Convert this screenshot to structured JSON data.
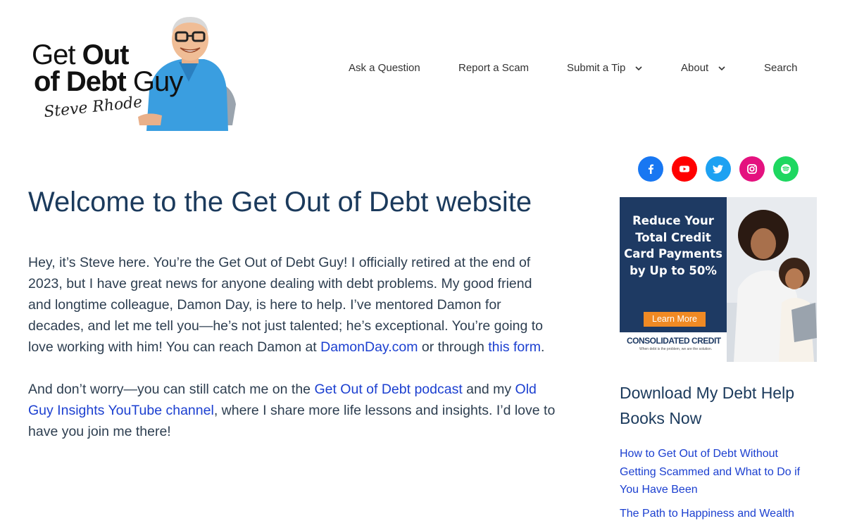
{
  "header": {
    "logo": {
      "line1_a": "Get ",
      "line1_b": "Out",
      "line2_a": "of Debt",
      "line2_b": " Guy",
      "signature": "Steve Rhode"
    },
    "nav": [
      {
        "label": "Ask a Question",
        "has_dropdown": false
      },
      {
        "label": "Report a Scam",
        "has_dropdown": false
      },
      {
        "label": "Submit a Tip",
        "has_dropdown": true
      },
      {
        "label": "About",
        "has_dropdown": true
      },
      {
        "label": "Search",
        "has_dropdown": false
      }
    ]
  },
  "main": {
    "title": "Welcome to the Get Out of Debt website",
    "para1": {
      "text": "Hey, it’s Steve here. You’re the Get Out of Debt Guy! I officially retired at the end of 2023, but I have great news for anyone dealing with debt problems. My good friend and longtime colleague, Damon Day, is here to help. I’ve mentored Damon for decades, and let me tell you—he’s not just talented; he’s exceptional. You’re going to love working with him! You can reach Damon at ",
      "link1": "DamonDay.com",
      "mid": " or through ",
      "link2": "this form",
      "end": "."
    },
    "para2": {
      "text": "And don’t worry—you can still catch me on the ",
      "link1": "Get Out of Debt podcast",
      "mid": " and my ",
      "link2": "Old Guy Insights YouTube channel",
      "end": ", where I share more life lessons and insights. I’d love to have you join me there!"
    }
  },
  "sidebar": {
    "socials": [
      {
        "name": "facebook",
        "color": "#1877f2"
      },
      {
        "name": "youtube",
        "color": "#ff0000"
      },
      {
        "name": "twitter",
        "color": "#1da1f2"
      },
      {
        "name": "instagram",
        "color": "#e4127f"
      },
      {
        "name": "spotify",
        "color": "#1ed760"
      }
    ],
    "ad": {
      "headline": "Reduce Your Total Credit Card Payments by Up to 50%",
      "cta": "Learn More",
      "brand": "CONSOLIDATED CREDIT",
      "tagline": "When debt is the problem, we are the solution."
    },
    "books_title": "Download My Debt Help Books Now",
    "books": [
      "How to Get Out of Debt Without Getting Scammed and What to Do if You Have Been",
      "The Path to Happiness and Wealth"
    ]
  },
  "colors": {
    "title": "#1b3a5c",
    "link": "#1b3fd0",
    "ad_navy": "#1e3a63",
    "ad_cta": "#f08a24"
  }
}
